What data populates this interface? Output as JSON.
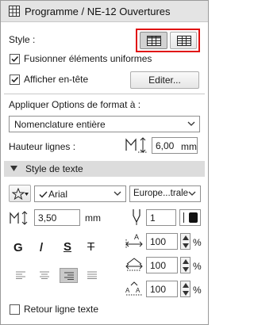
{
  "window": {
    "title": "Programme / NE-12 Ouvertures"
  },
  "style": {
    "label": "Style :"
  },
  "options": {
    "merge_label": "Fusionner éléments uniformes",
    "merge_checked": true,
    "header_label": "Afficher en-tête",
    "header_checked": true,
    "edit_button": "Editer..."
  },
  "format": {
    "apply_label": "Appliquer Options de format à :",
    "scope_value": "Nomenclature entière",
    "row_height_label": "Hauteur lignes :",
    "row_height_value": "6,00",
    "row_height_unit": "mm"
  },
  "text_style": {
    "section_title": "Style de texte",
    "font_value": "Arial",
    "charset_value": "Europe...trale",
    "size_value": "3,50",
    "size_unit": "mm",
    "pen_value": "1",
    "width_value": "100",
    "spacing_value": "100",
    "height_value": "100",
    "percent": "%",
    "bold_glyph": "G",
    "italic_glyph": "/",
    "underline_glyph": "S",
    "strike_glyph": "T"
  },
  "wrap": {
    "label": "Retour ligne texte",
    "checked": false
  },
  "colors": {
    "accent_red": "#e01010",
    "header_bg": "#e4e4e4",
    "section_bg": "#dcdcdc"
  }
}
